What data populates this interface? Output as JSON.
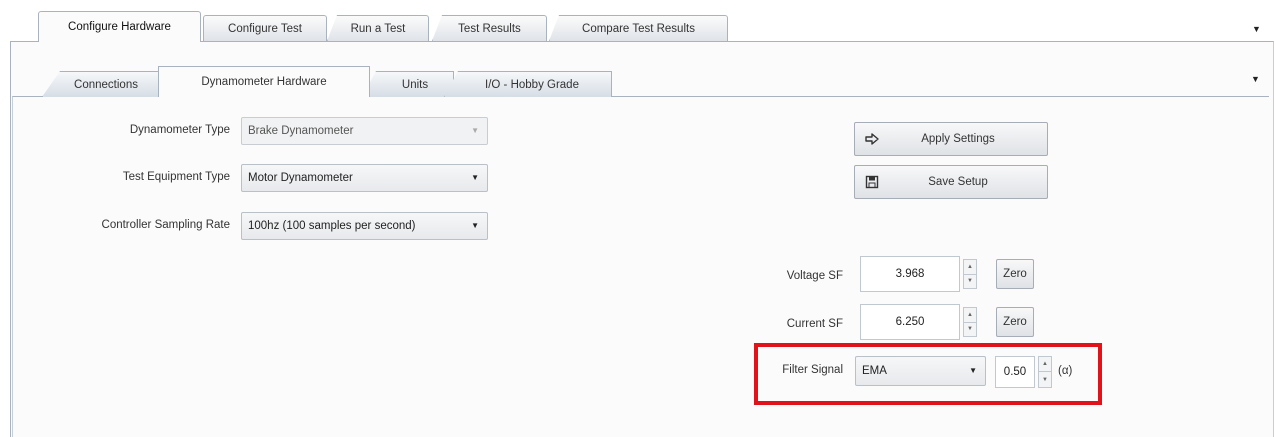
{
  "top_tabs": [
    {
      "label": "Configure Hardware",
      "active": true
    },
    {
      "label": "Configure Test",
      "active": false
    },
    {
      "label": "Run a Test",
      "active": false
    },
    {
      "label": "Test Results",
      "active": false
    },
    {
      "label": "Compare Test Results",
      "active": false
    }
  ],
  "inner_tabs": [
    {
      "label": "Connections",
      "active": false
    },
    {
      "label": "Dynamometer Hardware",
      "active": true
    },
    {
      "label": "Units",
      "active": false
    },
    {
      "label": "I/O - Hobby Grade",
      "active": false
    }
  ],
  "form": {
    "dynamometer_type": {
      "label": "Dynamometer Type",
      "value": "Brake Dynamometer",
      "enabled": false
    },
    "test_equipment_type": {
      "label": "Test Equipment Type",
      "value": "Motor Dynamometer"
    },
    "sampling_rate": {
      "label": "Controller Sampling Rate",
      "value": "100hz  (100 samples per second)"
    }
  },
  "actions": {
    "apply_label": "Apply Settings",
    "save_label": "Save Setup"
  },
  "scale_factors": {
    "voltage": {
      "label": "Voltage SF",
      "value": "3.968",
      "zero_label": "Zero"
    },
    "current": {
      "label": "Current SF",
      "value": "6.250",
      "zero_label": "Zero"
    }
  },
  "filter": {
    "label": "Filter Signal",
    "mode": "EMA",
    "alpha_value": "0.50",
    "alpha_unit": "(α)"
  },
  "colors": {
    "highlight": "#e0121a",
    "tab_border": "#a9b3bf"
  },
  "icons": {
    "apply": "arrow-right-icon",
    "save": "floppy-disk-icon",
    "dropdown": "chevron-down-icon"
  }
}
